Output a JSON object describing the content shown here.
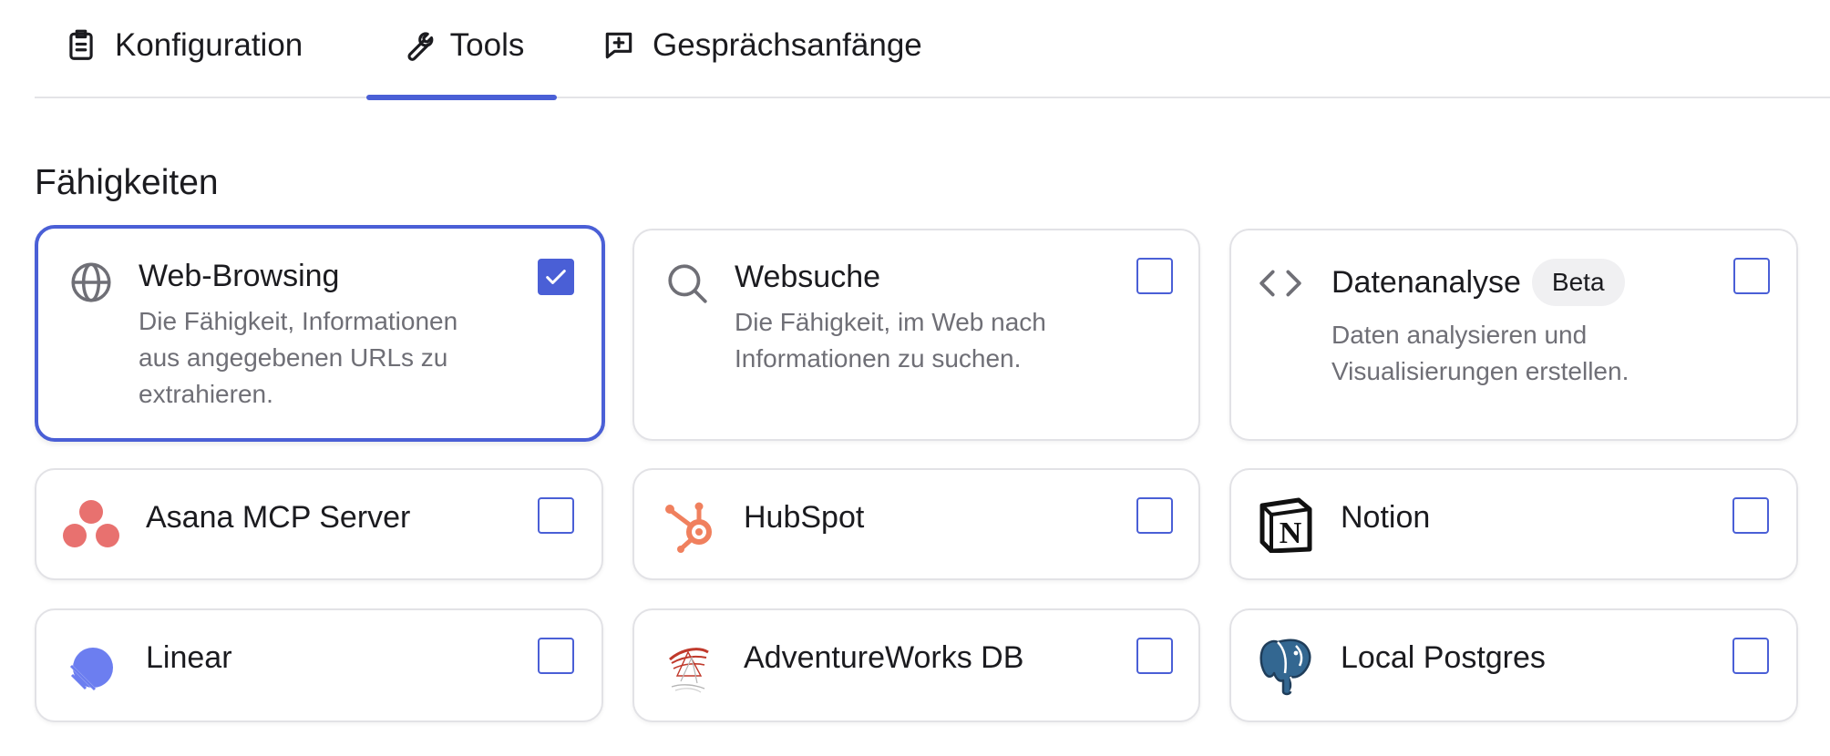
{
  "tabs": [
    {
      "label": "Konfiguration",
      "icon": "clipboard-icon",
      "active": false
    },
    {
      "label": "Tools",
      "icon": "wrench-icon",
      "active": true
    },
    {
      "label": "Gesprächsanfänge",
      "icon": "message-plus-icon",
      "active": false
    }
  ],
  "section": {
    "title": "Fähigkeiten"
  },
  "capabilities": [
    {
      "title": "Web-Browsing",
      "description": "Die Fähigkeit, Informationen aus angegebenen URLs zu extrahieren.",
      "icon": "globe-icon",
      "checked": true
    },
    {
      "title": "Websuche",
      "description": "Die Fähigkeit, im Web nach Informationen zu suchen.",
      "icon": "search-icon",
      "checked": false
    },
    {
      "title": "Datenanalyse",
      "badge": "Beta",
      "description": "Daten analysieren und Visualisierungen erstellen.",
      "icon": "code-icon",
      "checked": false
    }
  ],
  "tools": [
    {
      "title": "Asana MCP Server",
      "icon": "asana-logo-icon",
      "checked": false
    },
    {
      "title": "HubSpot",
      "icon": "hubspot-logo-icon",
      "checked": false
    },
    {
      "title": "Notion",
      "icon": "notion-logo-icon",
      "checked": false
    },
    {
      "title": "Linear",
      "icon": "linear-logo-icon",
      "checked": false
    },
    {
      "title": "AdventureWorks DB",
      "icon": "sql-server-logo-icon",
      "checked": false
    },
    {
      "title": "Local Postgres",
      "icon": "postgres-elephant-icon",
      "checked": false
    }
  ],
  "colors": {
    "accent": "#4a5fd6",
    "border": "#e2e2e6",
    "text": "#1b1b1f",
    "muted": "#6f6f76",
    "asana": "#e8716f",
    "hubspot": "#f0805e",
    "linear": "#6c7ef0"
  }
}
